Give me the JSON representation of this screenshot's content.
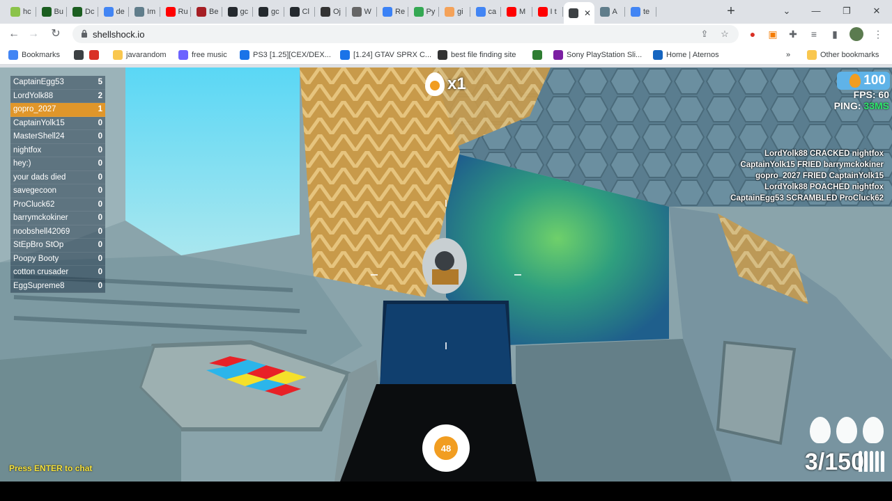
{
  "browser": {
    "tabs": [
      {
        "label": "hc",
        "color": "#8bc34a"
      },
      {
        "label": "Bu",
        "color": "#1b5e20"
      },
      {
        "label": "Dc",
        "color": "#1b5e20"
      },
      {
        "label": "de",
        "color": "#4285f4"
      },
      {
        "label": "Im",
        "color": "#607d8b"
      },
      {
        "label": "Ru",
        "color": "#ff0000"
      },
      {
        "label": "Be",
        "color": "#a51e24"
      },
      {
        "label": "gc",
        "color": "#24292e"
      },
      {
        "label": "gc",
        "color": "#24292e"
      },
      {
        "label": "Cl",
        "color": "#24292e"
      },
      {
        "label": "Oj",
        "color": "#333333"
      },
      {
        "label": "W",
        "color": "#666666"
      },
      {
        "label": "Re",
        "color": "#3b82f6"
      },
      {
        "label": "Py",
        "color": "#34a853"
      },
      {
        "label": "gi",
        "color": "#f4a259"
      },
      {
        "label": "ca",
        "color": "#4285f4"
      },
      {
        "label": "M",
        "color": "#ff0000"
      },
      {
        "label": "I t",
        "color": "#ff0000"
      },
      {
        "label": "",
        "color": "#3c4043",
        "active": true
      },
      {
        "label": "A",
        "color": "#607d8b"
      },
      {
        "label": "te",
        "color": "#4285f4"
      }
    ],
    "url": "shellshock.io",
    "bookmarks": [
      {
        "label": "Bookmarks",
        "color": "#4285f4"
      },
      {
        "label": "",
        "color": "#3c4043"
      },
      {
        "label": "",
        "color": "#d93025"
      },
      {
        "label": "javarandom",
        "color": "#f9c74f"
      },
      {
        "label": "free music",
        "color": "#6c63ff"
      },
      {
        "label": "PS3 [1.25][CEX/DEX...",
        "color": "#1a73e8"
      },
      {
        "label": "[1.24] GTAV SPRX C...",
        "color": "#1a73e8"
      },
      {
        "label": "best file finding site",
        "color": "#333333"
      },
      {
        "label": "",
        "color": "#2e7d32"
      },
      {
        "label": "Sony PlayStation Sli...",
        "color": "#7b1fa2"
      },
      {
        "label": "Home | Aternos",
        "color": "#1565c0"
      }
    ],
    "other_bookmarks": "Other bookmarks",
    "more_bookmarks": "»"
  },
  "game": {
    "leaderboard": [
      {
        "name": "CaptainEgg53",
        "score": "5"
      },
      {
        "name": "LordYolk88",
        "score": "2"
      },
      {
        "name": "gopro_2027",
        "score": "1",
        "me": true
      },
      {
        "name": "CaptainYolk15",
        "score": "0"
      },
      {
        "name": "MasterShell24",
        "score": "0"
      },
      {
        "name": "nightfox",
        "score": "0"
      },
      {
        "name": "hey:)",
        "score": "0"
      },
      {
        "name": "your dads died",
        "score": "0"
      },
      {
        "name": "savegecoon",
        "score": "0"
      },
      {
        "name": "ProCluck62",
        "score": "0"
      },
      {
        "name": "barrymckokiner",
        "score": "0"
      },
      {
        "name": "noobshell42069",
        "score": "0"
      },
      {
        "name": "StEpBro StOp",
        "score": "0"
      },
      {
        "name": "Poopy Booty",
        "score": "0"
      },
      {
        "name": "cotton crusader",
        "score": "0"
      },
      {
        "name": "EggSupreme8",
        "score": "0"
      }
    ],
    "eggs": "100",
    "fps_label": "FPS: 60",
    "ping_label": "PING: ",
    "ping_value": "33MS",
    "streak": "x1",
    "killfeed": [
      "LordYolk88 CRACKED nightfox",
      "CaptainYolk15 FRIED barrymckokiner",
      "gopro_2027 FRIED CaptainYolk15",
      "LordYolk88 POACHED nightfox",
      "CaptainEgg53 SCRAMBLED ProCluck62"
    ],
    "ammo_ring": "48",
    "ammo": "3/150",
    "chat_prompt": "Press ENTER to chat",
    "accent": "#f19d21"
  }
}
